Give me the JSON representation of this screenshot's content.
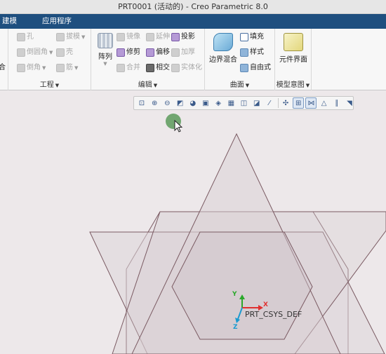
{
  "window": {
    "title": "PRT0001 (活动的) - Creo Parametric 8.0"
  },
  "tabs": [
    {
      "label": "建模"
    },
    {
      "label": "应用程序"
    }
  ],
  "ribbon": {
    "engineering": {
      "label": "工程",
      "items": {
        "hole": "孔",
        "draft": "拔模",
        "round": "倒圆角",
        "shell": "壳",
        "chamfer": "倒角",
        "rib": "筋",
        "partial_left_top": "合"
      }
    },
    "editing": {
      "label": "编辑",
      "pattern": "阵列",
      "items": {
        "mirror": "镜像",
        "extend": "延伸",
        "project": "投影",
        "trim": "修剪",
        "offset": "偏移",
        "thicken": "加厚",
        "merge": "合并",
        "intersect": "相交",
        "solidify": "实体化"
      }
    },
    "surfaces": {
      "label": "曲面",
      "boundary_blend": "边界混合",
      "fill": "填充",
      "style": "样式",
      "freestyle": "自由式"
    },
    "model_intent": {
      "label": "模型意图",
      "component_interface": "元件界面"
    }
  },
  "viewport": {
    "csys_label": "PRT_CSYS_DEF",
    "axes": {
      "x": "X",
      "y": "Y",
      "z": "Z"
    }
  },
  "colors": {
    "tabbar": "#1e4f7f",
    "viewport_bg": "#ede8ea",
    "surface_edge": "#7a5a62",
    "axis_x": "#e03030",
    "axis_y": "#2aa82a",
    "axis_z": "#1a9ad0"
  }
}
